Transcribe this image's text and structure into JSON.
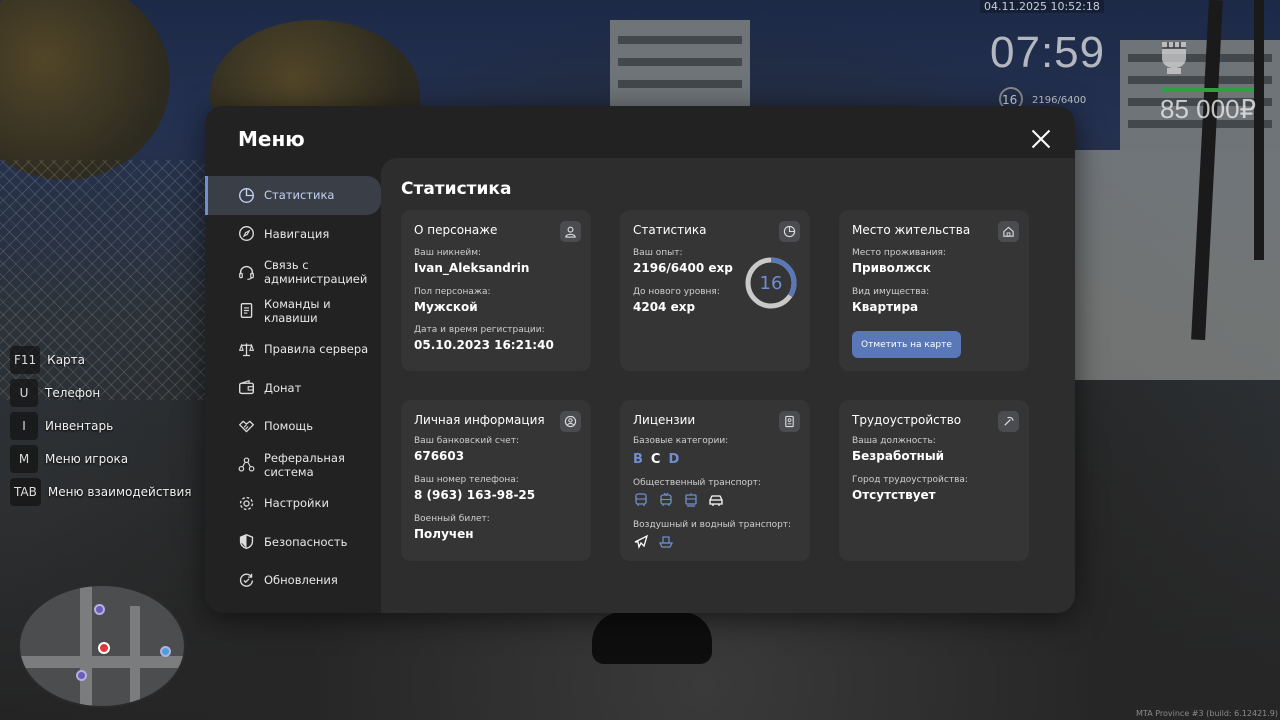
{
  "hud": {
    "datetime": "04.11.2025 10:52:18",
    "time": "07:59",
    "level": "16",
    "exp": "2196/6400",
    "money": "85 000₽"
  },
  "keybinds": [
    {
      "key": "F11",
      "label": "Карта"
    },
    {
      "key": "U",
      "label": "Телефон"
    },
    {
      "key": "I",
      "label": "Инвентарь"
    },
    {
      "key": "M",
      "label": "Меню игрока"
    },
    {
      "key": "TAB",
      "label": "Меню взаимодействия"
    }
  ],
  "menu": {
    "title": "Меню",
    "sidebar": [
      {
        "label": "Статистика",
        "icon": "chart-pie-icon",
        "active": true
      },
      {
        "label": "Навигация",
        "icon": "compass-icon"
      },
      {
        "label": "Связь с администрацией",
        "icon": "headset-icon"
      },
      {
        "label": "Команды и клавиши",
        "icon": "document-icon"
      },
      {
        "label": "Правила сервера",
        "icon": "scales-icon"
      },
      {
        "label": "Донат",
        "icon": "wallet-icon"
      },
      {
        "label": "Помощь",
        "icon": "handshake-icon"
      },
      {
        "label": "Реферальная система",
        "icon": "network-icon"
      },
      {
        "label": "Настройки",
        "icon": "gear-icon"
      },
      {
        "label": "Безопасность",
        "icon": "shield-icon"
      },
      {
        "label": "Обновления",
        "icon": "refresh-check-icon"
      }
    ]
  },
  "stats": {
    "title": "Статистика",
    "character": {
      "title": "О персонаже",
      "nickname_label": "Ваш никнейм:",
      "nickname": "Ivan_Aleksandrin",
      "gender_label": "Пол персонажа:",
      "gender": "Мужской",
      "reg_label": "Дата и время регистрации:",
      "reg": "05.10.2023 16:21:40"
    },
    "statistics": {
      "title": "Статистика",
      "exp_label": "Ваш опыт:",
      "exp": "2196/6400 exp",
      "next_label": "До нового уровня:",
      "next": "4204 exp",
      "level": "16",
      "progress": 0.343
    },
    "residence": {
      "title": "Место жительства",
      "place_label": "Место проживания:",
      "place": "Приволжск",
      "type_label": "Вид имущества:",
      "type": "Квартира",
      "button": "Отметить на карте"
    },
    "personal": {
      "title": "Личная информация",
      "bank_label": "Ваш банковский счет:",
      "bank": "676603",
      "phone_label": "Ваш номер телефона:",
      "phone": "8 (963) 163-98-25",
      "military_label": "Военный билет:",
      "military": "Получен"
    },
    "licenses": {
      "title": "Лицензии",
      "base_label": "Базовые категории:",
      "categories": [
        {
          "letter": "B",
          "color": "#6f8fd1"
        },
        {
          "letter": "C",
          "color": "#ffffff"
        },
        {
          "letter": "D",
          "color": "#6f8fd1"
        }
      ],
      "public_label": "Общественный транспорт:",
      "air_label": "Воздушный и водный транспорт:"
    },
    "employment": {
      "title": "Трудоустройство",
      "position_label": "Ваша должность:",
      "position": "Безработный",
      "city_label": "Город трудоустройства:",
      "city": "Отсутствует"
    }
  },
  "watermark": "MTA Province #3 (build: 6.12421.9)",
  "colors": {
    "accent": "#6f8fd1",
    "button": "#5a78b8",
    "card": "#353536",
    "panel": "#2d2d2e"
  }
}
